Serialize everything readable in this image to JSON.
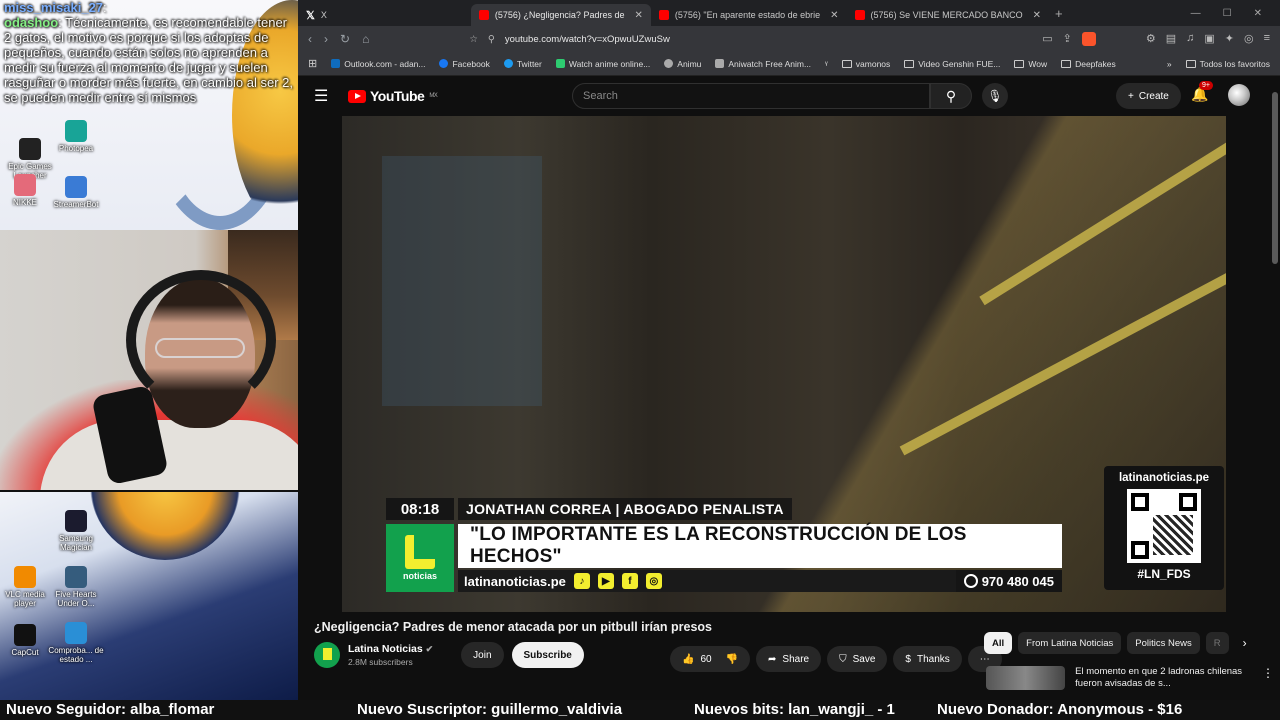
{
  "chat": {
    "messages": [
      {
        "user": "miss_misaki_27",
        "text": ""
      },
      {
        "user": "odashoo",
        "text": "Técnicamente, es recomendable tener 2 gatos, el motivo es porque si los adoptas de pequeños, cuando están solos no aprenden a medir su fuerza al momento de jugar y suelen rasguñar o morder más fuerte, en cambio al ser 2, se pueden medir entre sí mismos"
      }
    ]
  },
  "desktop_icons": [
    {
      "label": "Epic Games Launcher",
      "color": "#222222"
    },
    {
      "label": "Photopea",
      "color": "#18a497"
    },
    {
      "label": "NIKKE",
      "color": "#e46a7a"
    },
    {
      "label": "StreamerBot",
      "color": "#3a7bd5"
    },
    {
      "label": "Samsung Magician",
      "color": "#1b1b2e"
    },
    {
      "label": "VLC media player",
      "color": "#f18a00"
    },
    {
      "label": "Five Hearts Under O...",
      "color": "#355c7d"
    },
    {
      "label": "CapCut",
      "color": "#111111"
    },
    {
      "label": "Comproba... de estado ...",
      "color": "#2a8fd6"
    }
  ],
  "browser": {
    "tabs": [
      {
        "label": "X",
        "icon": "x-logo-icon",
        "active": false
      },
      {
        "label": "(5756) ¿Negligencia? Padres de",
        "icon": "youtube-icon",
        "active": true
      },
      {
        "label": "(5756) \"En aparente estado de ebrie",
        "icon": "youtube-icon",
        "active": false
      },
      {
        "label": "(5756) Se VIENE MERCADO BANCO",
        "icon": "youtube-icon",
        "active": false
      }
    ],
    "url": "youtube.com/watch?v=xOpwuUZwuSw",
    "bookmarks": [
      {
        "label": "Outlook.com - adan...",
        "color": "#0f6cbd"
      },
      {
        "label": "Facebook",
        "color": "#1877f2"
      },
      {
        "label": "Twitter",
        "color": "#1d9bf0"
      },
      {
        "label": "Watch anime online...",
        "color": "#2ecc71"
      },
      {
        "label": "Animu",
        "color": "#aaaaaa"
      },
      {
        "label": "Aniwatch Free Anim...",
        "color": "#aaaaaa"
      },
      {
        "label": "vamonos",
        "color": "folder"
      },
      {
        "label": "Video Genshin FUE...",
        "color": "folder"
      },
      {
        "label": "Wow",
        "color": "folder"
      },
      {
        "label": "Deepfakes",
        "color": "folder"
      }
    ],
    "bookmarks_other": "Todos los favoritos"
  },
  "youtube": {
    "logo": "YouTube",
    "region": "MX",
    "search_placeholder": "Search",
    "create_label": "Create",
    "notif_count": "9+",
    "video_title": "¿Negligencia? Padres de menor atacada por un pitbull irían presos",
    "channel_name": "Latina Noticias",
    "subscribers": "2.8M subscribers",
    "join_label": "Join",
    "subscribe_label": "Subscribe",
    "likes": "60",
    "share_label": "Share",
    "save_label": "Save",
    "thanks_label": "Thanks",
    "chips": [
      "All",
      "From Latina Noticias",
      "Politics News",
      "R"
    ],
    "rec_title": "El momento en que 2 ladronas chilenas fueron avisadas de s..."
  },
  "overlay": {
    "time": "08:18",
    "name": "JONATHAN CORREA | ABOGADO PENALISTA",
    "quote": "\"LO IMPORTANTE ES LA RECONSTRUCCIÓN DE LOS HECHOS\"",
    "logo_word": "noticias",
    "site": "latinanoticias.pe",
    "phone": "970 480 045",
    "qr_site": "latinanoticias.pe",
    "hashtag": "#LN_FDS"
  },
  "ticker": [
    "Nuevo Seguidor: alba_flomar",
    "Nuevo Suscriptor: guillermo_valdivia",
    "Nuevos bits: lan_wangji_ - 1",
    "Nuevo Donador: Anonymous - $16"
  ]
}
